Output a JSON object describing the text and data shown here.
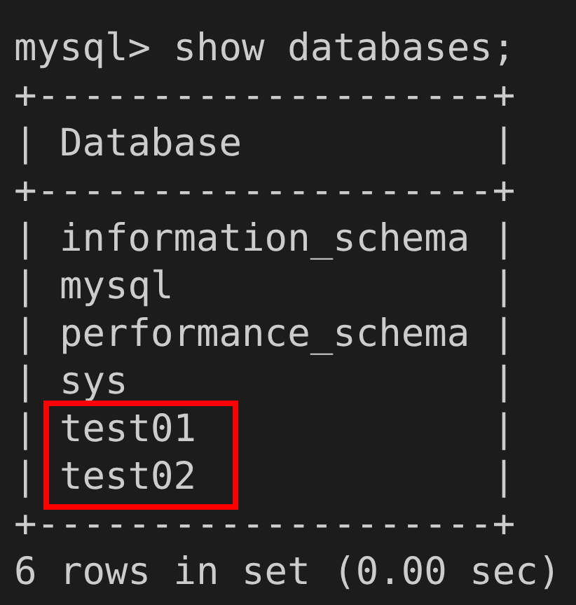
{
  "command": "mysql> show databases;",
  "border_top": "+--------------------+",
  "header": "| Database           |",
  "border_mid": "+--------------------+",
  "rows": [
    {
      "text": "| information_schema |",
      "highlighted": false
    },
    {
      "text": "| mysql              |",
      "highlighted": false
    },
    {
      "text": "| performance_schema |",
      "highlighted": false
    },
    {
      "text": "| sys                |",
      "highlighted": false
    },
    {
      "text": "| test01             |",
      "highlighted": true
    },
    {
      "text": "| test02             |",
      "highlighted": true
    }
  ],
  "border_bottom": "+--------------------+",
  "summary": "6 rows in set (0.00 sec)"
}
